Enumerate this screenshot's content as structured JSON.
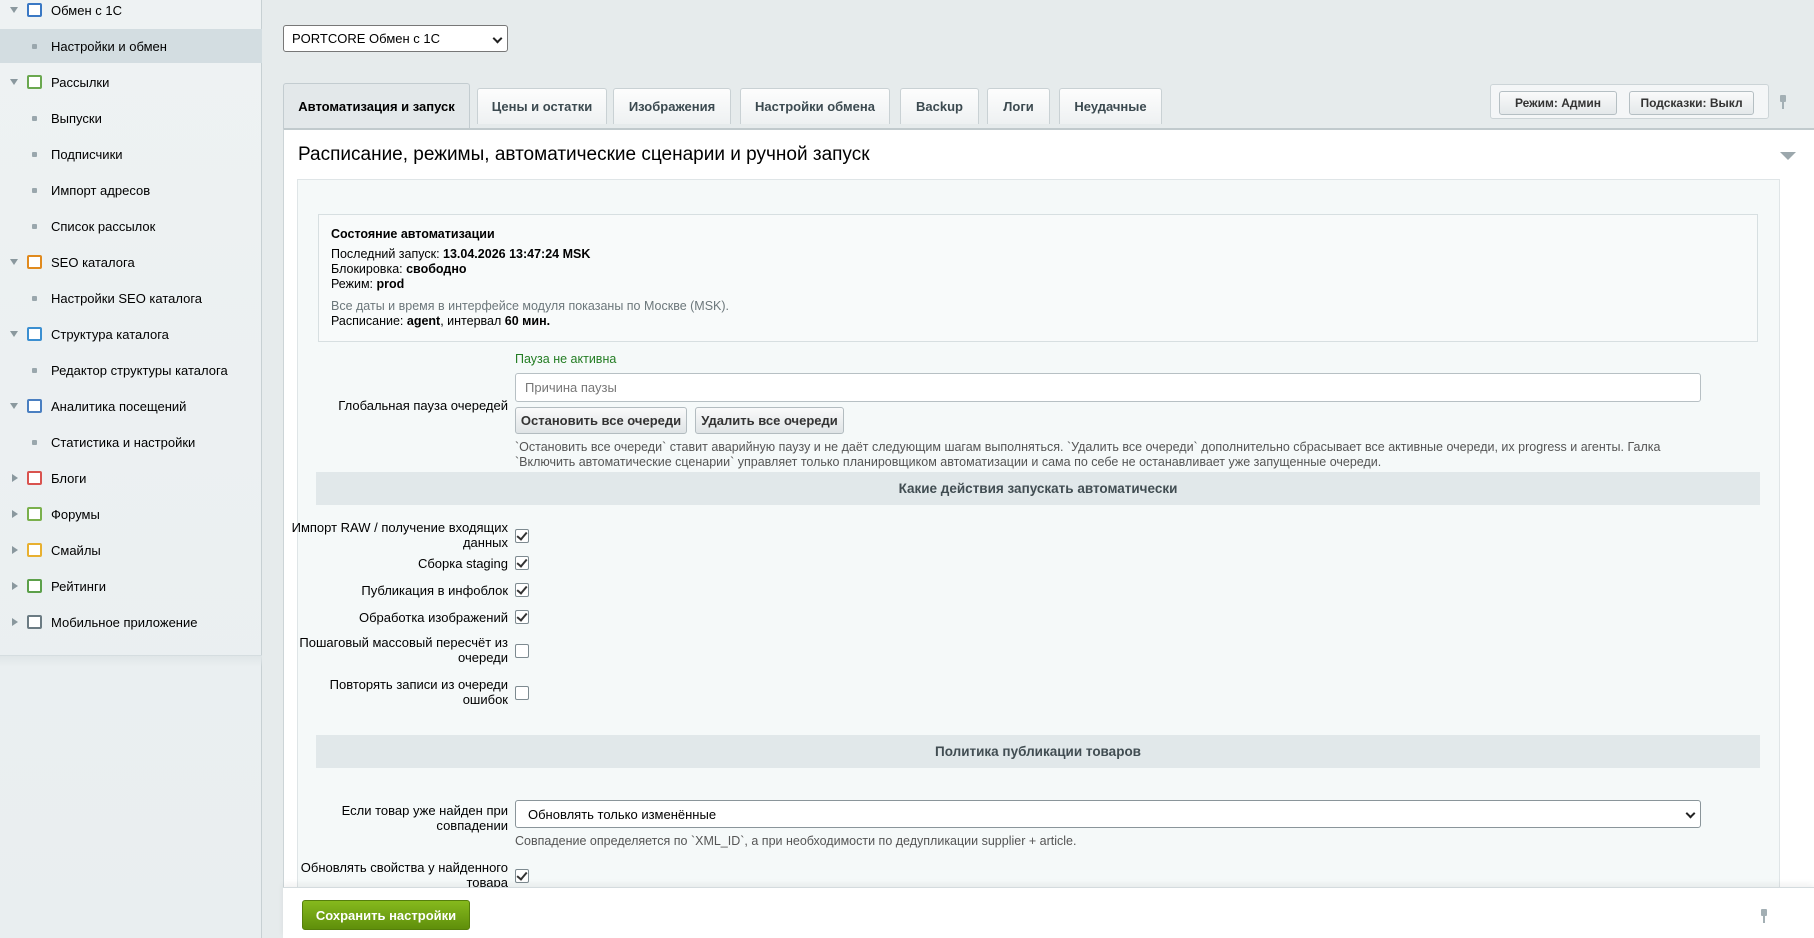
{
  "sidebar": {
    "items": [
      {
        "label": "Обмен с 1С",
        "level": 1,
        "arrow": "down",
        "icon": "exchange-icon",
        "color": "#3a78c4"
      },
      {
        "label": "Настройки и обмен",
        "level": 2,
        "active": true
      },
      {
        "label": "Рассылки",
        "level": 1,
        "arrow": "down",
        "icon": "mail-icon",
        "color": "#6aa84f"
      },
      {
        "label": "Выпуски",
        "level": 2
      },
      {
        "label": "Подписчики",
        "level": 2
      },
      {
        "label": "Импорт адресов",
        "level": 2
      },
      {
        "label": "Список рассылок",
        "level": 2
      },
      {
        "label": "SEO каталога",
        "level": 1,
        "arrow": "down",
        "icon": "seo-search-icon",
        "color": "#e08a1e"
      },
      {
        "label": "Настройки SEO каталога",
        "level": 2
      },
      {
        "label": "Структура каталога",
        "level": 1,
        "arrow": "down",
        "icon": "structure-icon",
        "color": "#3b8fd1"
      },
      {
        "label": "Редактор структуры каталога",
        "level": 2
      },
      {
        "label": "Аналитика посещений",
        "level": 1,
        "arrow": "down",
        "icon": "analytics-icon",
        "color": "#4a7fc1"
      },
      {
        "label": "Статистика и настройки",
        "level": 2
      },
      {
        "label": "Блоги",
        "level": 1,
        "arrow": "right",
        "icon": "blog-icon",
        "color": "#d9534f"
      },
      {
        "label": "Форумы",
        "level": 1,
        "arrow": "right",
        "icon": "forum-icon",
        "color": "#7ab04c"
      },
      {
        "label": "Смайлы",
        "level": 1,
        "arrow": "right",
        "icon": "smile-icon",
        "color": "#e8b030"
      },
      {
        "label": "Рейтинги",
        "level": 1,
        "arrow": "right",
        "icon": "rating-icon",
        "color": "#5ca04a"
      },
      {
        "label": "Мобильное приложение",
        "level": 1,
        "arrow": "right",
        "icon": "mobile-icon",
        "color": "#6b7b83"
      }
    ]
  },
  "profile_select": {
    "value": "PORTCORE Обмен с 1С"
  },
  "tabs": [
    {
      "label": "Автоматизация и запуск",
      "active": true
    },
    {
      "label": "Цены и остатки"
    },
    {
      "label": "Изображения"
    },
    {
      "label": "Настройки обмена"
    },
    {
      "label": "Backup"
    },
    {
      "label": "Логи"
    },
    {
      "label": "Неудачные"
    }
  ],
  "mode": {
    "admin": "Режим: Админ",
    "hints": "Подсказки: Выкл"
  },
  "panel": {
    "title": "Расписание, режимы, автоматические сценарии и ручной запуск"
  },
  "status": {
    "title": "Состояние автоматизации",
    "last_run_label": "Последний запуск: ",
    "last_run_value": "13.04.2026 13:47:24 MSK",
    "lock_label": "Блокировка: ",
    "lock_value": "свободно",
    "mode_label": "Режим: ",
    "mode_value": "prod",
    "tz_note": "Все даты и время в интерфейсе модуля показаны по Москве (MSK).",
    "schedule_label": "Расписание: ",
    "schedule_agent": "agent",
    "schedule_mid": ", интервал ",
    "schedule_interval": "60 мин."
  },
  "pause": {
    "state": "Пауза не активна",
    "label": "Глобальная пауза очередей",
    "placeholder": "Причина паузы",
    "stop_all": "Остановить все очереди",
    "delete_all": "Удалить все очереди",
    "note_line1": "`Остановить все очереди` ставит аварийную паузу и не даёт следующим шагам выполняться. `Удалить все очереди` дополнительно сбрасывает все активные очереди, их progress и агенты. Галка",
    "note_line2": "`Включить автоматические сценарии` управляет только планировщиком автоматизации и сама по себе не останавливает уже запущенные очереди."
  },
  "auto_actions": {
    "title": "Какие действия запускать автоматически",
    "items": [
      {
        "label_1": "Импорт RAW / получение входящих",
        "label_2": "данных",
        "checked": true
      },
      {
        "label_1": "Сборка staging",
        "checked": true
      },
      {
        "label_1": "Публикация в инфоблок",
        "checked": true
      },
      {
        "label_1": "Обработка изображений",
        "checked": true
      },
      {
        "label_1": "Пошаговый массовый пересчёт из",
        "label_2": "очереди",
        "checked": false
      },
      {
        "label_1": "Повторять записи из очереди",
        "label_2": "ошибок",
        "checked": false
      }
    ]
  },
  "publish_policy": {
    "title": "Политика публикации товаров",
    "found_label_1": "Если товар уже найден при",
    "found_label_2": "совпадении",
    "found_value": "Обновлять только изменённые",
    "match_note": "Совпадение определяется по `XML_ID`, а при необходимости по дедупликации supplier + article.",
    "props_label_1": "Обновлять свойства у найденного",
    "props_label_2": "товара",
    "props_checked": true
  },
  "footer": {
    "save": "Сохранить настройки"
  }
}
